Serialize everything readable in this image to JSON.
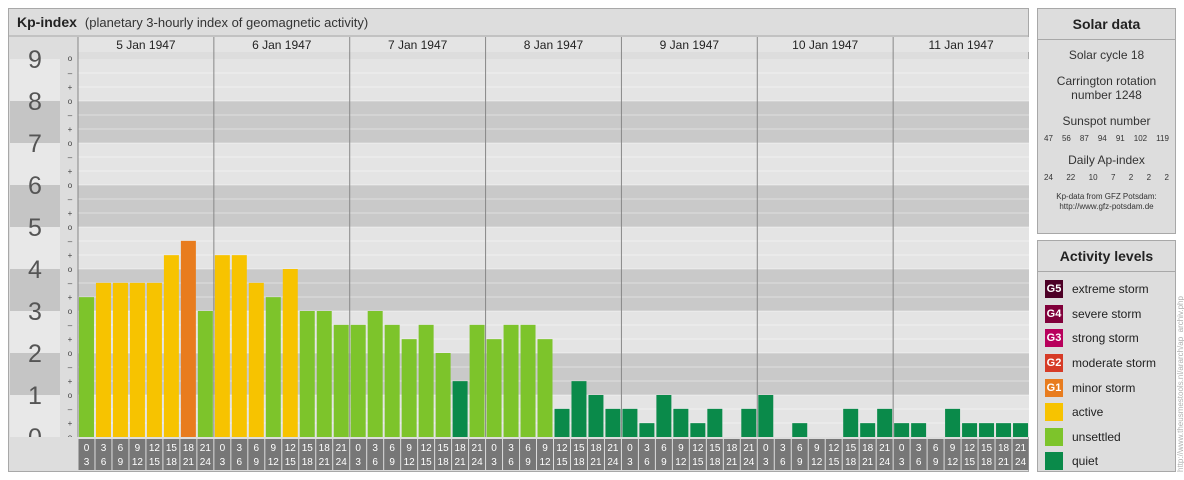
{
  "title": "Kp-index",
  "subtitle": "(planetary 3-hourly index of geomagnetic activity)",
  "chart_data": {
    "type": "bar",
    "title": "Kp-index",
    "subtitle": "(planetary 3-hourly index of geomagnetic activity)",
    "ylim": [
      0,
      9
    ],
    "y_ticks": [
      "0",
      "1",
      "2",
      "3",
      "4",
      "5",
      "6",
      "7",
      "8",
      "9"
    ],
    "minor_tick_labels": [
      "o",
      "+",
      "–"
    ],
    "days": [
      "5 Jan 1947",
      "6 Jan 1947",
      "7 Jan 1947",
      "8 Jan 1947",
      "9 Jan 1947",
      "10 Jan 1947",
      "11 Jan 1947"
    ],
    "interval_start_labels": [
      "0",
      "3",
      "6",
      "9",
      "12",
      "15",
      "18",
      "21"
    ],
    "interval_end_labels": [
      "3",
      "6",
      "9",
      "12",
      "15",
      "18",
      "21",
      "24"
    ],
    "kp_values": [
      3.33,
      3.67,
      3.67,
      3.67,
      3.67,
      4.33,
      4.67,
      3.0,
      4.33,
      4.33,
      3.67,
      3.33,
      4.0,
      3.0,
      3.0,
      2.67,
      2.67,
      3.0,
      2.67,
      2.33,
      2.67,
      2.0,
      1.33,
      2.67,
      2.33,
      2.67,
      2.67,
      2.33,
      0.67,
      1.33,
      1.0,
      0.67,
      0.67,
      0.33,
      1.0,
      0.67,
      0.33,
      0.67,
      0.0,
      0.67,
      1.0,
      0.0,
      0.33,
      0.0,
      0.0,
      0.67,
      0.33,
      0.67,
      0.33,
      0.33,
      0.0,
      0.67,
      0.33,
      0.33,
      0.33,
      0.33
    ]
  },
  "solar": {
    "title": "Solar data",
    "cycle": "Solar cycle 18",
    "carrington_1": "Carrington rotation",
    "carrington_2": "number 1248",
    "sunspot_title": "Sunspot number",
    "sunspot_values": [
      "47",
      "56",
      "87",
      "94",
      "91",
      "102",
      "119"
    ],
    "ap_title": "Daily Ap-index",
    "ap_values": [
      "24",
      "22",
      "10",
      "7",
      "2",
      "2",
      "2"
    ],
    "credit_1": "Kp-data from GFZ Potsdam:",
    "credit_2": "http://www.gfz-potsdam.de"
  },
  "activity": {
    "title": "Activity levels",
    "levels": [
      {
        "code": "G5",
        "label": "extreme storm",
        "color": "#4d0026"
      },
      {
        "code": "G4",
        "label": "severe storm",
        "color": "#80003a"
      },
      {
        "code": "G3",
        "label": "strong storm",
        "color": "#b8005c"
      },
      {
        "code": "G2",
        "label": "moderate storm",
        "color": "#d63b26"
      },
      {
        "code": "G1",
        "label": "minor storm",
        "color": "#e87c1e"
      },
      {
        "code": "",
        "label": "active",
        "color": "#f7c300"
      },
      {
        "code": "",
        "label": "unsettled",
        "color": "#7dc42b"
      },
      {
        "code": "",
        "label": "quiet",
        "color": "#0a8a4a"
      }
    ]
  },
  "watermark": "http://www.theusmestools.nl/ararch/ap_archiv.php"
}
